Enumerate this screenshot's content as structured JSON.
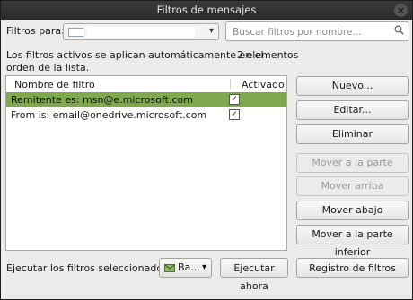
{
  "window": {
    "title": "Filtros de mensajes"
  },
  "toolbar": {
    "filters_for_label": "Filtros para:",
    "folder_value": "",
    "search_placeholder": "Buscar filtros por nombre..."
  },
  "status": {
    "info_line1": "Los filtros activos se aplican automáticamente en el",
    "info_line2": "orden de la lista.",
    "count": "2 elementos"
  },
  "list": {
    "col_name": "Nombre de filtro",
    "col_enabled": "Activado",
    "rows": [
      {
        "name": "Remitente es: msn@e.microsoft.com",
        "enabled": true,
        "selected": true
      },
      {
        "name": "From is: email@onedrive.microsoft.com",
        "enabled": true,
        "selected": false
      }
    ]
  },
  "buttons": {
    "new": "Nuevo...",
    "edit": "Editar...",
    "delete": "Eliminar",
    "move_top": "Mover a la parte superior",
    "move_up": "Mover arriba",
    "move_down": "Mover abajo",
    "move_bottom": "Mover a la parte inferior"
  },
  "footer": {
    "run_label": "Ejecutar los filtros seleccionados en:",
    "account_value": "Ba...",
    "run_now": "Ejecutar ahora",
    "log": "Registro de filtros"
  },
  "colors": {
    "selection": "#7fa94f",
    "titlebar": "#2e2e2e"
  },
  "icons": [
    "close-icon",
    "envelope-icon",
    "chevron-down-icon",
    "search-icon",
    "checkmark-icon",
    "inbox-icon"
  ]
}
